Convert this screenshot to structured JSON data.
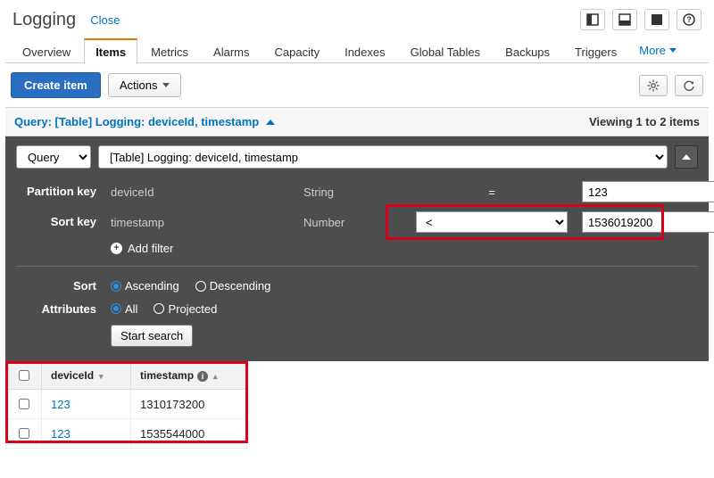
{
  "header": {
    "title": "Logging",
    "close": "Close"
  },
  "tabs": {
    "items": [
      "Overview",
      "Items",
      "Metrics",
      "Alarms",
      "Capacity",
      "Indexes",
      "Global Tables",
      "Backups",
      "Triggers"
    ],
    "active_index": 1,
    "more": "More"
  },
  "toolbar": {
    "create": "Create item",
    "actions": "Actions"
  },
  "query_header": {
    "label": "Query: [Table] Logging: deviceId, timestamp",
    "viewing": "Viewing 1 to 2 items"
  },
  "panel": {
    "mode_select": "Query",
    "table_select": "[Table] Logging: deviceId, timestamp",
    "pk": {
      "label": "Partition key",
      "name": "deviceId",
      "type": "String",
      "op": "=",
      "value": "123"
    },
    "sk": {
      "label": "Sort key",
      "name": "timestamp",
      "type": "Number",
      "op": "<",
      "value": "1536019200"
    },
    "add_filter": "Add filter",
    "sort": {
      "label": "Sort",
      "asc": "Ascending",
      "desc": "Descending",
      "selected": "asc"
    },
    "attrs": {
      "label": "Attributes",
      "all": "All",
      "proj": "Projected",
      "selected": "all"
    },
    "start": "Start search"
  },
  "results": {
    "cols": [
      "deviceId",
      "timestamp"
    ],
    "rows": [
      {
        "deviceId": "123",
        "timestamp": "1310173200"
      },
      {
        "deviceId": "123",
        "timestamp": "1535544000"
      }
    ]
  }
}
